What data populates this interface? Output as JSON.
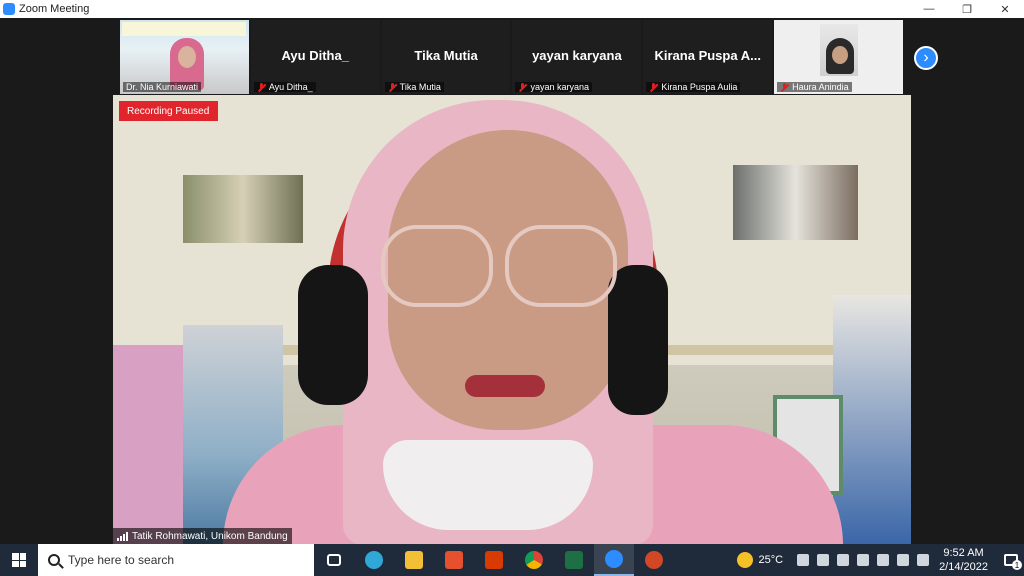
{
  "window": {
    "title": "Zoom Meeting",
    "minimize_icon": "minimize-icon",
    "restore_icon": "restore-icon",
    "close_icon": "close-icon"
  },
  "gallery": {
    "tiles": [
      {
        "type": "video",
        "name": "Dr. Nia Kurniawati",
        "muted": false
      },
      {
        "type": "name",
        "display": "Ayu Ditha_",
        "name": "Ayu Ditha_",
        "muted": true
      },
      {
        "type": "name",
        "display": "Tika Mutia",
        "name": "Tika Mutia",
        "muted": true
      },
      {
        "type": "name",
        "display": "yayan karyana",
        "name": "yayan karyana",
        "muted": true
      },
      {
        "type": "name",
        "display": "Kirana  Puspa  A...",
        "name": "Kirana Puspa Aulia",
        "muted": true
      },
      {
        "type": "video",
        "name": "Haura Anindia",
        "muted": true
      }
    ],
    "next_icon": "chevron-right-icon"
  },
  "speaker": {
    "recording_status": "Recording Paused",
    "name": "Tatik Rohmawati, Unikom Bandung"
  },
  "taskbar": {
    "search_placeholder": "Type here to search",
    "apps": [
      {
        "icon": "task-view-icon",
        "color": "#ffffff"
      },
      {
        "icon": "edge-icon",
        "color": "#2fa8d8"
      },
      {
        "icon": "file-explorer-icon",
        "color": "#f2c037"
      },
      {
        "icon": "office-icon",
        "color": "#e5502f"
      },
      {
        "icon": "office-icon",
        "color": "#d83b01"
      },
      {
        "icon": "chrome-icon",
        "color": "#f4b400"
      },
      {
        "icon": "excel-icon",
        "color": "#1d7044"
      },
      {
        "icon": "zoom-icon",
        "color": "#2d8cff"
      },
      {
        "icon": "powerpoint-icon",
        "color": "#d24726"
      }
    ],
    "temperature": "25°C",
    "time": "9:52 AM",
    "date": "2/14/2022",
    "notification_count": "1"
  }
}
